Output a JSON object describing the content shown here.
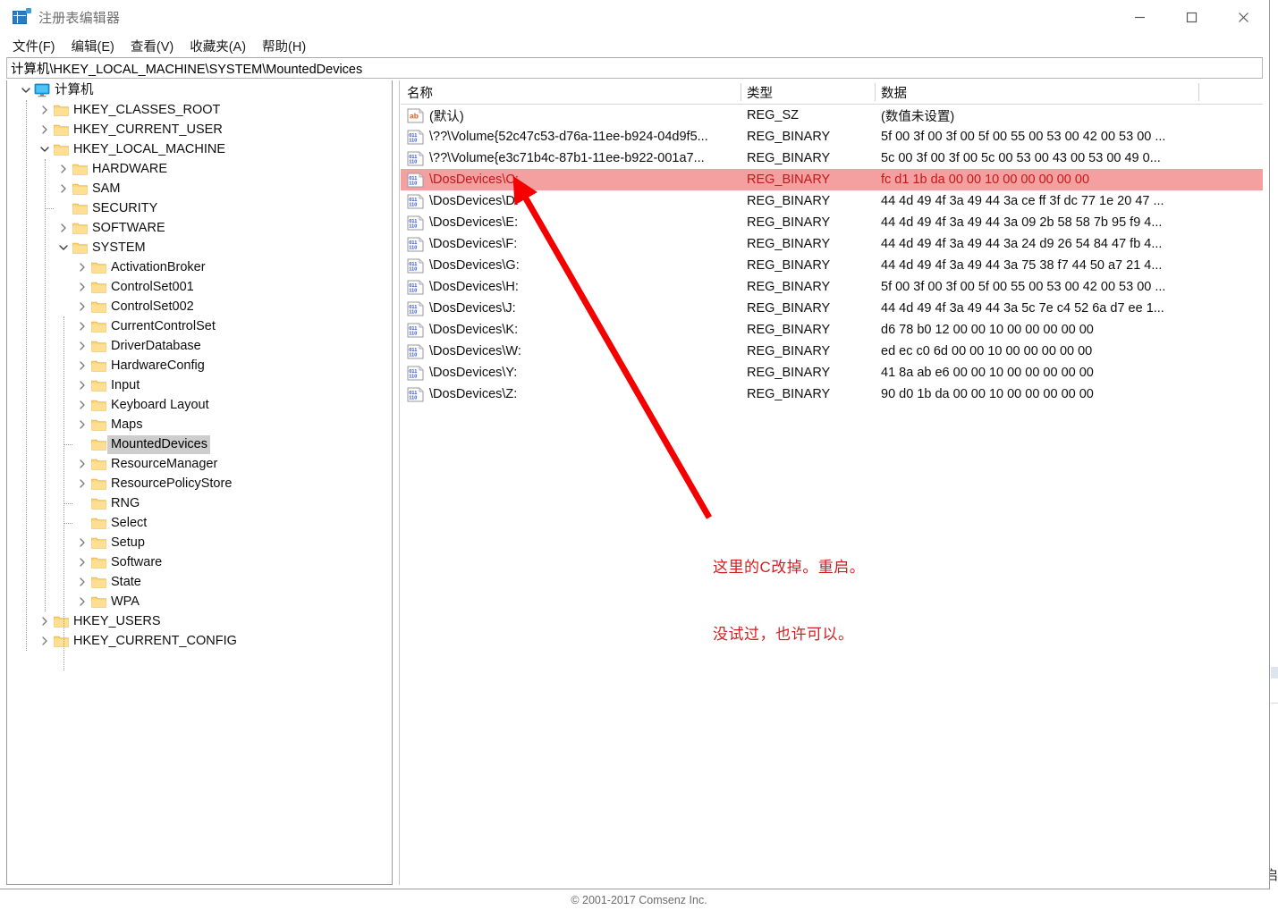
{
  "window": {
    "title": "注册表编辑器",
    "icon": "registry-editor-icon",
    "minimize_label": "最小化",
    "maximize_label": "最大化",
    "close_label": "关闭"
  },
  "menu": {
    "items": [
      {
        "label": "文件(F)",
        "name": "menu-file"
      },
      {
        "label": "编辑(E)",
        "name": "menu-edit"
      },
      {
        "label": "查看(V)",
        "name": "menu-view"
      },
      {
        "label": "收藏夹(A)",
        "name": "menu-favorites"
      },
      {
        "label": "帮助(H)",
        "name": "menu-help"
      }
    ]
  },
  "address": {
    "path": "计算机\\HKEY_LOCAL_MACHINE\\SYSTEM\\MountedDevices"
  },
  "tree": {
    "nodes": [
      {
        "label": "计算机",
        "depth": 0,
        "state": "expanded",
        "icon": "computer-icon",
        "selected": false
      },
      {
        "label": "HKEY_CLASSES_ROOT",
        "depth": 1,
        "state": "collapsed",
        "icon": "folder-icon",
        "selected": false
      },
      {
        "label": "HKEY_CURRENT_USER",
        "depth": 1,
        "state": "collapsed",
        "icon": "folder-icon",
        "selected": false
      },
      {
        "label": "HKEY_LOCAL_MACHINE",
        "depth": 1,
        "state": "expanded",
        "icon": "folder-icon",
        "selected": false
      },
      {
        "label": "HARDWARE",
        "depth": 2,
        "state": "collapsed",
        "icon": "folder-icon",
        "selected": false
      },
      {
        "label": "SAM",
        "depth": 2,
        "state": "collapsed",
        "icon": "folder-icon",
        "selected": false
      },
      {
        "label": "SECURITY",
        "depth": 2,
        "state": "leaf",
        "icon": "folder-icon",
        "selected": false
      },
      {
        "label": "SOFTWARE",
        "depth": 2,
        "state": "collapsed",
        "icon": "folder-icon",
        "selected": false
      },
      {
        "label": "SYSTEM",
        "depth": 2,
        "state": "expanded",
        "icon": "folder-icon",
        "selected": false
      },
      {
        "label": "ActivationBroker",
        "depth": 3,
        "state": "collapsed",
        "icon": "folder-icon",
        "selected": false
      },
      {
        "label": "ControlSet001",
        "depth": 3,
        "state": "collapsed",
        "icon": "folder-icon",
        "selected": false
      },
      {
        "label": "ControlSet002",
        "depth": 3,
        "state": "collapsed",
        "icon": "folder-icon",
        "selected": false
      },
      {
        "label": "CurrentControlSet",
        "depth": 3,
        "state": "collapsed",
        "icon": "folder-icon",
        "selected": false
      },
      {
        "label": "DriverDatabase",
        "depth": 3,
        "state": "collapsed",
        "icon": "folder-icon",
        "selected": false
      },
      {
        "label": "HardwareConfig",
        "depth": 3,
        "state": "collapsed",
        "icon": "folder-icon",
        "selected": false
      },
      {
        "label": "Input",
        "depth": 3,
        "state": "collapsed",
        "icon": "folder-icon",
        "selected": false
      },
      {
        "label": "Keyboard Layout",
        "depth": 3,
        "state": "collapsed",
        "icon": "folder-icon",
        "selected": false
      },
      {
        "label": "Maps",
        "depth": 3,
        "state": "collapsed",
        "icon": "folder-icon",
        "selected": false
      },
      {
        "label": "MountedDevices",
        "depth": 3,
        "state": "leaf",
        "icon": "folder-icon",
        "selected": true
      },
      {
        "label": "ResourceManager",
        "depth": 3,
        "state": "collapsed",
        "icon": "folder-icon",
        "selected": false
      },
      {
        "label": "ResourcePolicyStore",
        "depth": 3,
        "state": "collapsed",
        "icon": "folder-icon",
        "selected": false
      },
      {
        "label": "RNG",
        "depth": 3,
        "state": "leaf",
        "icon": "folder-icon",
        "selected": false
      },
      {
        "label": "Select",
        "depth": 3,
        "state": "leaf",
        "icon": "folder-icon",
        "selected": false
      },
      {
        "label": "Setup",
        "depth": 3,
        "state": "collapsed",
        "icon": "folder-icon",
        "selected": false
      },
      {
        "label": "Software",
        "depth": 3,
        "state": "collapsed",
        "icon": "folder-icon",
        "selected": false
      },
      {
        "label": "State",
        "depth": 3,
        "state": "collapsed",
        "icon": "folder-icon",
        "selected": false
      },
      {
        "label": "WPA",
        "depth": 3,
        "state": "collapsed",
        "icon": "folder-icon",
        "selected": false
      },
      {
        "label": "HKEY_USERS",
        "depth": 1,
        "state": "collapsed",
        "icon": "folder-icon",
        "selected": false
      },
      {
        "label": "HKEY_CURRENT_CONFIG",
        "depth": 1,
        "state": "collapsed",
        "icon": "folder-icon",
        "selected": false
      }
    ]
  },
  "list": {
    "columns": [
      {
        "label": "名称",
        "name": "column-name"
      },
      {
        "label": "类型",
        "name": "column-type"
      },
      {
        "label": "数据",
        "name": "column-data"
      }
    ],
    "rows": [
      {
        "name": "(默认)",
        "type": "REG_SZ",
        "data": "(数值未设置)",
        "icon": "string-value-icon",
        "highlight": false
      },
      {
        "name": "\\??\\Volume{52c47c53-d76a-11ee-b924-04d9f5...",
        "type": "REG_BINARY",
        "data": "5f 00 3f 00 3f 00 5f 00 55 00 53 00 42 00 53 00 ...",
        "icon": "binary-value-icon",
        "highlight": false
      },
      {
        "name": "\\??\\Volume{e3c71b4c-87b1-11ee-b922-001a7...",
        "type": "REG_BINARY",
        "data": "5c 00 3f 00 3f 00 5c 00 53 00 43 00 53 00 49 0...",
        "icon": "binary-value-icon",
        "highlight": false
      },
      {
        "name": "\\DosDevices\\C:",
        "type": "REG_BINARY",
        "data": "fc d1 1b da 00 00 10 00 00 00 00 00",
        "icon": "binary-value-icon",
        "highlight": true
      },
      {
        "name": "\\DosDevices\\D:",
        "type": "REG_BINARY",
        "data": "44 4d 49 4f 3a 49 44 3a ce ff 3f dc 77 1e 20 47 ...",
        "icon": "binary-value-icon",
        "highlight": false
      },
      {
        "name": "\\DosDevices\\E:",
        "type": "REG_BINARY",
        "data": "44 4d 49 4f 3a 49 44 3a 09 2b 58 58 7b 95 f9 4...",
        "icon": "binary-value-icon",
        "highlight": false
      },
      {
        "name": "\\DosDevices\\F:",
        "type": "REG_BINARY",
        "data": "44 4d 49 4f 3a 49 44 3a 24 d9 26 54 84 47 fb 4...",
        "icon": "binary-value-icon",
        "highlight": false
      },
      {
        "name": "\\DosDevices\\G:",
        "type": "REG_BINARY",
        "data": "44 4d 49 4f 3a 49 44 3a 75 38 f7 44 50 a7 21 4...",
        "icon": "binary-value-icon",
        "highlight": false
      },
      {
        "name": "\\DosDevices\\H:",
        "type": "REG_BINARY",
        "data": "5f 00 3f 00 3f 00 5f 00 55 00 53 00 42 00 53 00 ...",
        "icon": "binary-value-icon",
        "highlight": false
      },
      {
        "name": "\\DosDevices\\J:",
        "type": "REG_BINARY",
        "data": "44 4d 49 4f 3a 49 44 3a 5c 7e c4 52 6a d7 ee 1...",
        "icon": "binary-value-icon",
        "highlight": false
      },
      {
        "name": "\\DosDevices\\K:",
        "type": "REG_BINARY",
        "data": "d6 78 b0 12 00 00 10 00 00 00 00 00",
        "icon": "binary-value-icon",
        "highlight": false
      },
      {
        "name": "\\DosDevices\\W:",
        "type": "REG_BINARY",
        "data": "ed ec c0 6d 00 00 10 00 00 00 00 00",
        "icon": "binary-value-icon",
        "highlight": false
      },
      {
        "name": "\\DosDevices\\Y:",
        "type": "REG_BINARY",
        "data": "41 8a ab e6 00 00 10 00 00 00 00 00",
        "icon": "binary-value-icon",
        "highlight": false
      },
      {
        "name": "\\DosDevices\\Z:",
        "type": "REG_BINARY",
        "data": "90 d0 1b da 00 00 10 00 00 00 00 00",
        "icon": "binary-value-icon",
        "highlight": false
      }
    ]
  },
  "annotation": {
    "line1": "这里的C改掉。重启。",
    "line2": "没试过，也许可以。",
    "color": "#cf2020",
    "arrow_color": "#f40000"
  },
  "background": {
    "partial_char": "启"
  },
  "footer": {
    "text": "© 2001-2017 Comsenz Inc."
  }
}
